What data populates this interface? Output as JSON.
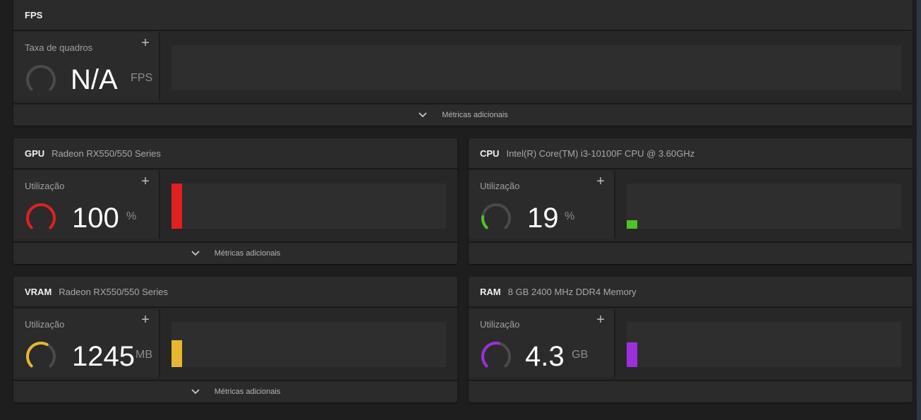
{
  "fps": {
    "title": "FPS",
    "metric": {
      "label": "Taxa de quadros",
      "value": "N/A",
      "unit": "FPS",
      "fraction": 0,
      "color": "#4a4a4a"
    },
    "footer_label": "Métricas adicionais",
    "icons": {
      "add": "plus-icon",
      "expand": "chevron-down-icon"
    }
  },
  "gpu": {
    "title": "GPU",
    "subtitle": "Radeon RX550/550 Series",
    "metric": {
      "label": "Utilização",
      "value": "100",
      "unit": "%",
      "fraction": 1.0,
      "color": "#e02020",
      "bar_fraction": 1.0
    },
    "footer_label": "Métricas adicionais"
  },
  "cpu": {
    "title": "CPU",
    "subtitle": "Intel(R) Core(TM) i3-10100F CPU @ 3.60GHz",
    "metric": {
      "label": "Utilização",
      "value": "19",
      "unit": "%",
      "fraction": 0.19,
      "color": "#4cc22c",
      "bar_fraction": 0.19
    }
  },
  "vram": {
    "title": "VRAM",
    "subtitle": "Radeon RX550/550 Series",
    "metric": {
      "label": "Utilização",
      "value": "1245",
      "unit": "MB",
      "fraction": 0.6,
      "color": "#e8b730",
      "bar_fraction": 0.6
    },
    "footer_label": "Métricas adicionais"
  },
  "ram": {
    "title": "RAM",
    "subtitle": "8 GB 2400 MHz DDR4 Memory",
    "metric": {
      "label": "Utilização",
      "value": "4.3",
      "unit": "GB",
      "fraction": 0.54,
      "color": "#9b30d9",
      "bar_fraction": 0.54
    }
  },
  "colors": {
    "track": "#4a4a4a"
  }
}
